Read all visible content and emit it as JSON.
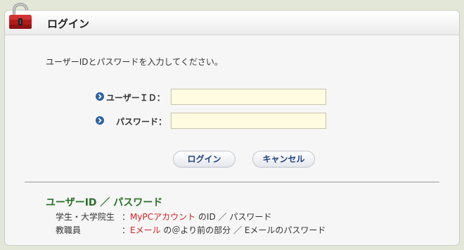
{
  "header": {
    "title": "ログイン"
  },
  "intro_text": "ユーザーIDとパスワードを入力してください。",
  "form": {
    "userid_label": "ユーザーＩＤ：",
    "userid_value": "",
    "password_label": "パスワード：",
    "password_value": ""
  },
  "buttons": {
    "login_label": "ログイン",
    "cancel_label": "キャンセル"
  },
  "info": {
    "title": "ユーザーID ／ パスワード",
    "lines": [
      {
        "label": "学生・大学院生",
        "colon": "：",
        "highlight": "MyPCアカウント",
        "rest": " のID ／ パスワード"
      },
      {
        "label": "教職員",
        "colon": "：",
        "highlight": "Eメール",
        "rest": " の＠より前の部分 ／ Eメールのパスワード"
      }
    ]
  },
  "colors": {
    "accent_green": "#287027",
    "link_red": "#cc2222",
    "button_text": "#1f3f80",
    "field_bg": "#fffce2",
    "page_bg": "#e3e7d7"
  }
}
